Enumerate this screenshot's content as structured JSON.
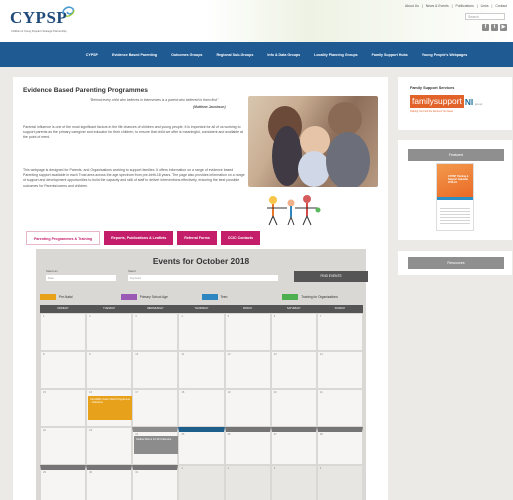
{
  "header": {
    "logo_text": "CYPSP",
    "logo_tagline": "Children & Young People's Strategic Partnership",
    "top_links": [
      "About Us",
      "|",
      "News & Events",
      "|",
      "Publications",
      "|",
      "Links",
      "|",
      "Contact"
    ],
    "search_placeholder": "Search",
    "social": [
      {
        "icon": "facebook-icon",
        "glyph": "f"
      },
      {
        "icon": "twitter-icon",
        "glyph": "t"
      },
      {
        "icon": "youtube-icon",
        "glyph": "▶"
      }
    ]
  },
  "nav": {
    "items": [
      "CYPSP",
      "Evidence Based Parenting",
      "Outcomes Groups",
      "Regional Sub-Groups",
      "Info & Data Groups",
      "Locality Planning Groups",
      "Family Support Hubs",
      "Young People's Webpages"
    ]
  },
  "main": {
    "title": "Evidence Based Parenting Programmes",
    "quote": "\"Behind every child who believes in themselves is a parent who believed in them first\"",
    "quote_author": "(Matthew Jacobson)",
    "para1": "Parental influence is one of the most significant factors in the life chances of children and young people. It is important for all of us working to support parents as the primary caregiver and educator for their children, to ensure that child we offer is meaningful, consistent and available at the point of need.",
    "para2": "This webpage is designed for Parents, and Organisations working to support families. It offers information on a range of evidence based Parenting support available in each Trust area across the age spectrum from pre-birth-18 years. The page also provides information on a range of support and development opportunities to build the capacity and skill of staff to deliver interventions effectively, ensuring the best possible outcomes for Parents/carers and children."
  },
  "tabs": [
    {
      "label": "Parenting Programmes & Training",
      "active": true
    },
    {
      "label": "Reports, Publications & Leaflets",
      "active": false
    },
    {
      "label": "Referral Forms",
      "active": false
    },
    {
      "label": "CCIC Contacts",
      "active": false
    }
  ],
  "calendar": {
    "title": "Events for October 2018",
    "field1_label": "Select an",
    "field1_value": "Date",
    "field2_label": "Select",
    "field2_value": "Keyword",
    "filter_label": "FIND EVENTS",
    "legend": [
      {
        "label": "Pre-Natal",
        "color": "#e8a11a"
      },
      {
        "label": "Primary School Age",
        "color": "#9b59b6"
      },
      {
        "label": "Teen",
        "color": "#2e86c1"
      },
      {
        "label": "Training for Organisations",
        "color": "#4caf50"
      }
    ],
    "day_names": [
      "MONDAY",
      "TUESDAY",
      "WEDNESDAY",
      "THURSDAY",
      "FRIDAY",
      "SATURDAY",
      "SUNDAY"
    ],
    "weeks": [
      [
        "1",
        "2",
        "3",
        "4",
        "5",
        "6",
        "7"
      ],
      [
        "8",
        "9",
        "10",
        "11",
        "12",
        "13",
        "14"
      ],
      [
        "15",
        "16",
        "17",
        "18",
        "19",
        "20",
        "21"
      ],
      [
        "22",
        "23",
        "24",
        "25",
        "26",
        "27",
        "28"
      ],
      [
        "29",
        "30",
        "31",
        "1",
        "2",
        "3",
        "4"
      ]
    ],
    "events": [
      {
        "text": "Incredible Years Infant Programme - Coleraine",
        "color": "#e8a11a"
      },
      {
        "text": "Mellow Mums 13-18 Coleraine",
        "color": "#8c8c8c"
      }
    ]
  },
  "sidebar": {
    "fss_title": "Family Support Services",
    "fss_logo_a": "familysupport",
    "fss_logo_b": "NI",
    "fss_logo_c": ".gov.uk",
    "fss_tagline": "Helping You Find the Services You Need",
    "featured_head": "Featured",
    "booklet_title": "CYPSP Training & Support Calendar 2018-19",
    "resources_head": "Resources"
  }
}
